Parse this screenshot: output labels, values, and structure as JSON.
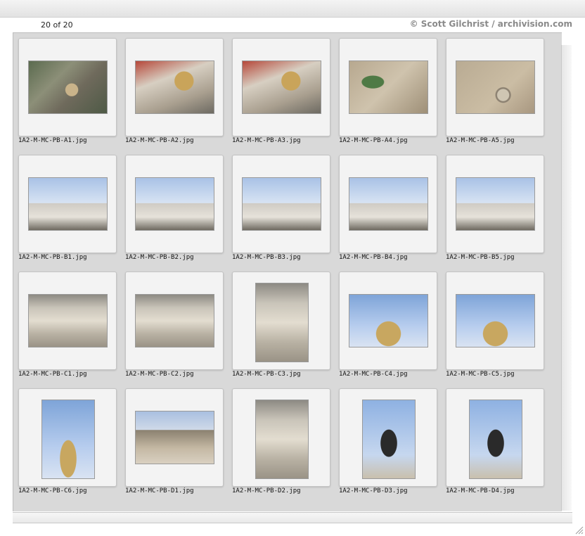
{
  "header": {
    "count": "20 of 20",
    "credit": "© Scott Gilchrist / archivision.com"
  },
  "thumbnails": [
    {
      "filename": "1A2-M-MC-PB-A1.jpg",
      "scene": "aerial-city",
      "orientation": "land"
    },
    {
      "filename": "1A2-M-MC-PB-A2.jpg",
      "scene": "aerial-dome",
      "orientation": "land"
    },
    {
      "filename": "1A2-M-MC-PB-A3.jpg",
      "scene": "aerial-dome",
      "orientation": "land"
    },
    {
      "filename": "1A2-M-MC-PB-A4.jpg",
      "scene": "aerial-plaza",
      "orientation": "land"
    },
    {
      "filename": "1A2-M-MC-PB-A5.jpg",
      "scene": "aerial-fountain",
      "orientation": "land"
    },
    {
      "filename": "1A2-M-MC-PB-B1.jpg",
      "scene": "facade-sky",
      "orientation": "land"
    },
    {
      "filename": "1A2-M-MC-PB-B2.jpg",
      "scene": "facade-sky",
      "orientation": "land"
    },
    {
      "filename": "1A2-M-MC-PB-B3.jpg",
      "scene": "facade-sky",
      "orientation": "land"
    },
    {
      "filename": "1A2-M-MC-PB-B4.jpg",
      "scene": "facade-sky",
      "orientation": "land"
    },
    {
      "filename": "1A2-M-MC-PB-B5.jpg",
      "scene": "facade-sky",
      "orientation": "land"
    },
    {
      "filename": "1A2-M-MC-PB-C1.jpg",
      "scene": "detail-stone",
      "orientation": "land"
    },
    {
      "filename": "1A2-M-MC-PB-C2.jpg",
      "scene": "detail-stone",
      "orientation": "land"
    },
    {
      "filename": "1A2-M-MC-PB-C3.jpg",
      "scene": "detail-stone",
      "orientation": "port"
    },
    {
      "filename": "1A2-M-MC-PB-C4.jpg",
      "scene": "statue-sky",
      "orientation": "land"
    },
    {
      "filename": "1A2-M-MC-PB-C5.jpg",
      "scene": "statue-sky",
      "orientation": "land"
    },
    {
      "filename": "1A2-M-MC-PB-C6.jpg",
      "scene": "statue-sky",
      "orientation": "port"
    },
    {
      "filename": "1A2-M-MC-PB-D1.jpg",
      "scene": "street-plaza",
      "orientation": "land"
    },
    {
      "filename": "1A2-M-MC-PB-D2.jpg",
      "scene": "detail-stone",
      "orientation": "port"
    },
    {
      "filename": "1A2-M-MC-PB-D3.jpg",
      "scene": "statue-dark",
      "orientation": "port"
    },
    {
      "filename": "1A2-M-MC-PB-D4.jpg",
      "scene": "statue-dark",
      "orientation": "port"
    }
  ]
}
